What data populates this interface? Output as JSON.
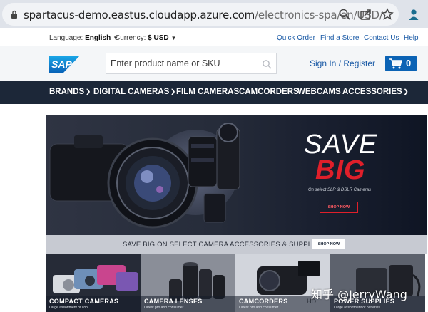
{
  "browser": {
    "url_host": "spartacus-demo.eastus.cloudapp.azure.com",
    "url_path": "/electronics-spa/en/USD/",
    "icons": [
      "lock-icon",
      "zoom-icon",
      "share-icon",
      "bookmark-star-icon",
      "profile-icon"
    ]
  },
  "utility": {
    "language_label": "Language:",
    "language_value": "English",
    "currency_label": "Currency:",
    "currency_value": "$ USD",
    "links": [
      "Quick Order",
      "Find a Store",
      "Contact Us",
      "Help"
    ]
  },
  "header": {
    "logo_text": "SAP",
    "search_placeholder": "Enter product name or SKU",
    "sign_in": "Sign In / Register",
    "cart_count": "0"
  },
  "nav": {
    "items": [
      "BRANDS",
      "DIGITAL CAMERAS",
      "FILM CAMERAS",
      "CAMCORDERS",
      "WEBCAMS",
      "ACCESSORIES"
    ]
  },
  "hero": {
    "line1": "SAVE",
    "line2": "BIG",
    "subtitle": "On select SLR & DSLR Cameras",
    "button": "SHOP NOW"
  },
  "promo": {
    "text": "SAVE BIG ON SELECT CAMERA ACCESSORIES & SUPPLIES",
    "button": "SHOP NOW"
  },
  "tiles": [
    {
      "title": "COMPACT CAMERAS",
      "subtitle": "Large assortment of cool"
    },
    {
      "title": "CAMERA LENSES",
      "subtitle": "Latest pro and consumer"
    },
    {
      "title": "CAMCORDERS",
      "subtitle": "Latest pro and consumer"
    },
    {
      "title": "POWER SUPPLIES",
      "subtitle": "Large assortment of batteries"
    }
  ],
  "watermark": "知乎 @JerryWang",
  "colors": {
    "nav_bg": "#1c2738",
    "accent_blue": "#0b63b5",
    "sale_red": "#e01f2a"
  }
}
